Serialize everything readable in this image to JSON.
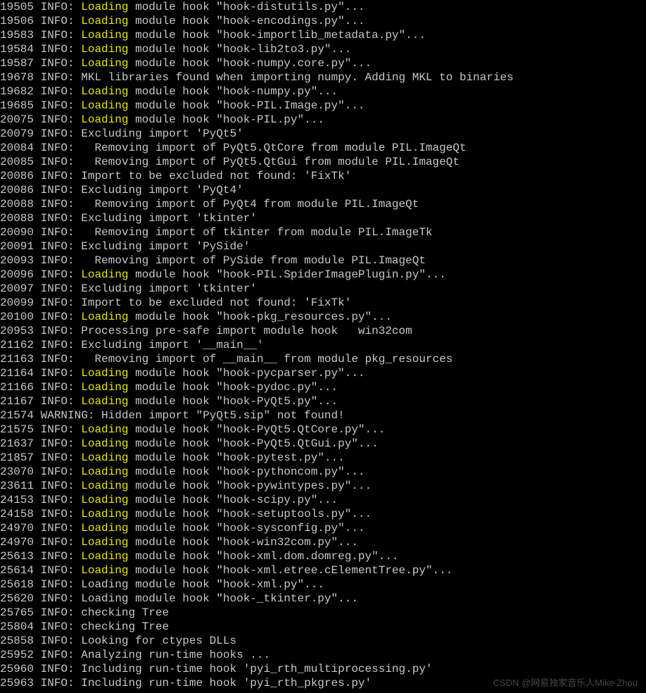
{
  "watermark": "CSDN @网易独家音乐人Mike Zhou",
  "lines": [
    {
      "ts": "19505",
      "level": "INFO",
      "hl": true,
      "msg": "Loading module hook \"hook-distutils.py\"..."
    },
    {
      "ts": "19506",
      "level": "INFO",
      "hl": true,
      "msg": "Loading module hook \"hook-encodings.py\"..."
    },
    {
      "ts": "19583",
      "level": "INFO",
      "hl": true,
      "msg": "Loading module hook \"hook-importlib_metadata.py\"..."
    },
    {
      "ts": "19584",
      "level": "INFO",
      "hl": true,
      "msg": "Loading module hook \"hook-lib2to3.py\"..."
    },
    {
      "ts": "19587",
      "level": "INFO",
      "hl": true,
      "msg": "Loading module hook \"hook-numpy.core.py\"..."
    },
    {
      "ts": "19678",
      "level": "INFO",
      "hl": false,
      "msg": "MKL libraries found when importing numpy. Adding MKL to binaries"
    },
    {
      "ts": "19682",
      "level": "INFO",
      "hl": true,
      "msg": "Loading module hook \"hook-numpy.py\"..."
    },
    {
      "ts": "19685",
      "level": "INFO",
      "hl": true,
      "msg": "Loading module hook \"hook-PIL.Image.py\"..."
    },
    {
      "ts": "20075",
      "level": "INFO",
      "hl": true,
      "msg": "Loading module hook \"hook-PIL.py\"..."
    },
    {
      "ts": "20079",
      "level": "INFO",
      "hl": false,
      "msg": "Excluding import 'PyQt5'"
    },
    {
      "ts": "20084",
      "level": "INFO",
      "hl": false,
      "msg": "  Removing import of PyQt5.QtCore from module PIL.ImageQt"
    },
    {
      "ts": "20085",
      "level": "INFO",
      "hl": false,
      "msg": "  Removing import of PyQt5.QtGui from module PIL.ImageQt"
    },
    {
      "ts": "20086",
      "level": "INFO",
      "hl": false,
      "msg": "Import to be excluded not found: 'FixTk'"
    },
    {
      "ts": "20086",
      "level": "INFO",
      "hl": false,
      "msg": "Excluding import 'PyQt4'"
    },
    {
      "ts": "20088",
      "level": "INFO",
      "hl": false,
      "msg": "  Removing import of PyQt4 from module PIL.ImageQt"
    },
    {
      "ts": "20088",
      "level": "INFO",
      "hl": false,
      "msg": "Excluding import 'tkinter'"
    },
    {
      "ts": "20090",
      "level": "INFO",
      "hl": false,
      "msg": "  Removing import of tkinter from module PIL.ImageTk"
    },
    {
      "ts": "20091",
      "level": "INFO",
      "hl": false,
      "msg": "Excluding import 'PySide'"
    },
    {
      "ts": "20093",
      "level": "INFO",
      "hl": false,
      "msg": "  Removing import of PySide from module PIL.ImageQt"
    },
    {
      "ts": "20096",
      "level": "INFO",
      "hl": true,
      "gr": true,
      "msg": "Loading module hook \"hook-PIL.SpiderImagePlugin.py\"..."
    },
    {
      "ts": "20097",
      "level": "INFO",
      "hl": false,
      "msg": "Excluding import 'tkinter'"
    },
    {
      "ts": "20099",
      "level": "INFO",
      "hl": false,
      "msg": "Import to be excluded not found: 'FixTk'"
    },
    {
      "ts": "20100",
      "level": "INFO",
      "hl": true,
      "msg": "Loading module hook \"hook-pkg_resources.py\"..."
    },
    {
      "ts": "20953",
      "level": "INFO",
      "hl": false,
      "msg": "Processing pre-safe import module hook   win32com"
    },
    {
      "ts": "21162",
      "level": "INFO",
      "hl": false,
      "msg": "Excluding import '__main__'"
    },
    {
      "ts": "21163",
      "level": "INFO",
      "hl": false,
      "msg": "  Removing import of __main__ from module pkg_resources"
    },
    {
      "ts": "21164",
      "level": "INFO",
      "hl": true,
      "msg": "Loading module hook \"hook-pycparser.py\"..."
    },
    {
      "ts": "21166",
      "level": "INFO",
      "hl": true,
      "msg": "Loading module hook \"hook-pydoc.py\"..."
    },
    {
      "ts": "21167",
      "level": "INFO",
      "hl": true,
      "msg": "Loading module hook \"hook-PyQt5.py\"..."
    },
    {
      "ts": "21574",
      "level": "WARNING",
      "hl": false,
      "msg": "Hidden import \"PyQt5.sip\" not found!"
    },
    {
      "ts": "21575",
      "level": "INFO",
      "hl": true,
      "msg": "Loading module hook \"hook-PyQt5.QtCore.py\"..."
    },
    {
      "ts": "21637",
      "level": "INFO",
      "hl": true,
      "msg": "Loading module hook \"hook-PyQt5.QtGui.py\"..."
    },
    {
      "ts": "21857",
      "level": "INFO",
      "hl": true,
      "msg": "Loading module hook \"hook-pytest.py\"..."
    },
    {
      "ts": "23070",
      "level": "INFO",
      "hl": true,
      "gr": true,
      "msg": "Loading module hook \"hook-pythoncom.py\"..."
    },
    {
      "ts": "23611",
      "level": "INFO",
      "hl": true,
      "gr": true,
      "msg": "Loading module hook \"hook-pywintypes.py\"..."
    },
    {
      "ts": "24153",
      "level": "INFO",
      "hl": true,
      "msg": "Loading module hook \"hook-scipy.py\"..."
    },
    {
      "ts": "24158",
      "level": "INFO",
      "hl": true,
      "msg": "Loading module hook \"hook-setuptools.py\"..."
    },
    {
      "ts": "24970",
      "level": "INFO",
      "hl": true,
      "msg": "Loading module hook \"hook-sysconfig.py\"..."
    },
    {
      "ts": "24970",
      "level": "INFO",
      "hl": true,
      "msg": "Loading module hook \"hook-win32com.py\"..."
    },
    {
      "ts": "25613",
      "level": "INFO",
      "hl": true,
      "msg": "Loading module hook \"hook-xml.dom.domreg.py\"..."
    },
    {
      "ts": "25614",
      "level": "INFO",
      "hl": true,
      "gr": true,
      "msg": "Loading module hook \"hook-xml.etree.cElementTree.py\"..."
    },
    {
      "ts": "25618",
      "level": "INFO",
      "hl": false,
      "msg": "Loading module hook \"hook-xml.py\"..."
    },
    {
      "ts": "25620",
      "level": "INFO",
      "hl": false,
      "msg": "Loading module hook \"hook-_tkinter.py\"..."
    },
    {
      "ts": "25765",
      "level": "INFO",
      "hl": false,
      "msg": "checking Tree"
    },
    {
      "ts": "25804",
      "level": "INFO",
      "hl": false,
      "msg": "checking Tree"
    },
    {
      "ts": "25858",
      "level": "INFO",
      "hl": false,
      "msg": "Looking for ctypes DLLs"
    },
    {
      "ts": "25952",
      "level": "INFO",
      "hl": false,
      "msg": "Analyzing run-time hooks ..."
    },
    {
      "ts": "25960",
      "level": "INFO",
      "hl": false,
      "msg": "Including run-time hook 'pyi_rth_multiprocessing.py'"
    },
    {
      "ts": "25963",
      "level": "INFO",
      "hl": false,
      "msg": "Including run-time hook 'pyi_rth_pkgres.py'"
    }
  ]
}
